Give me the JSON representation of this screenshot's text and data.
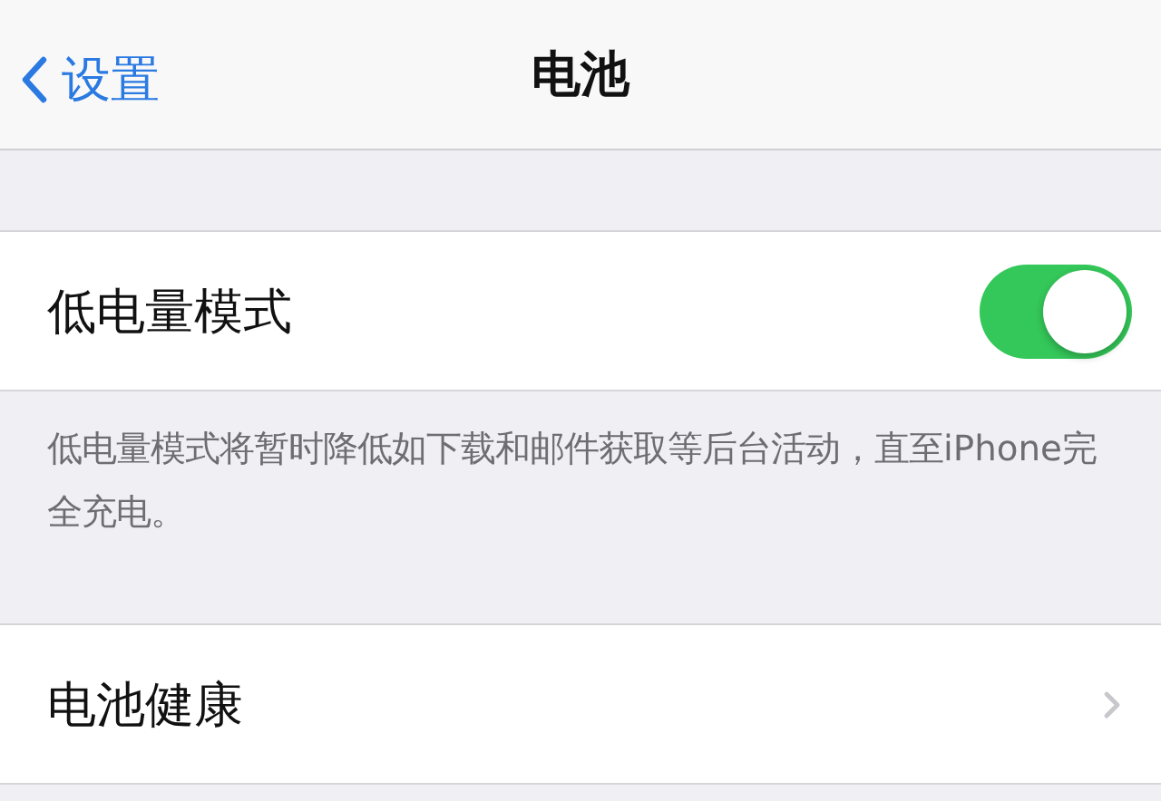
{
  "nav_bar": {
    "back_label": "设置",
    "title": "电池"
  },
  "sections": [
    {
      "rows": [
        {
          "kind": "toggle",
          "label": "低电量模式",
          "on": true
        }
      ],
      "footer": "低电量模式将暂时降低如下载和邮件获取等后台活动，直至iPhone完全充电。"
    },
    {
      "rows": [
        {
          "kind": "link",
          "label": "电池健康"
        }
      ]
    }
  ]
}
